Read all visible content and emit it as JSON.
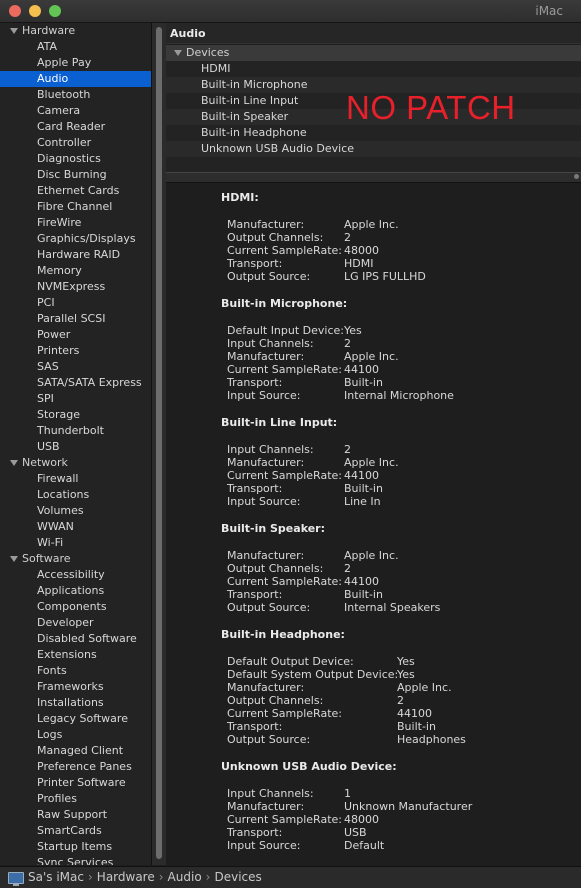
{
  "window": {
    "title": "iMac"
  },
  "sidebar": {
    "groups": [
      {
        "label": "Hardware",
        "items": [
          "ATA",
          "Apple Pay",
          "Audio",
          "Bluetooth",
          "Camera",
          "Card Reader",
          "Controller",
          "Diagnostics",
          "Disc Burning",
          "Ethernet Cards",
          "Fibre Channel",
          "FireWire",
          "Graphics/Displays",
          "Hardware RAID",
          "Memory",
          "NVMExpress",
          "PCI",
          "Parallel SCSI",
          "Power",
          "Printers",
          "SAS",
          "SATA/SATA Express",
          "SPI",
          "Storage",
          "Thunderbolt",
          "USB"
        ]
      },
      {
        "label": "Network",
        "items": [
          "Firewall",
          "Locations",
          "Volumes",
          "WWAN",
          "Wi-Fi"
        ]
      },
      {
        "label": "Software",
        "items": [
          "Accessibility",
          "Applications",
          "Components",
          "Developer",
          "Disabled Software",
          "Extensions",
          "Fonts",
          "Frameworks",
          "Installations",
          "Legacy Software",
          "Logs",
          "Managed Client",
          "Preference Panes",
          "Printer Software",
          "Profiles",
          "Raw Support",
          "SmartCards",
          "Startup Items",
          "Sync Services"
        ]
      }
    ],
    "selected": "Audio"
  },
  "main": {
    "section_title": "Audio",
    "devices_group": "Devices",
    "devices": [
      "HDMI",
      "Built-in Microphone",
      "Built-in Line Input",
      "Built-in Speaker",
      "Built-in Headphone",
      "Unknown USB Audio Device"
    ],
    "overlay_text": "NO PATCH"
  },
  "details": [
    {
      "title": "HDMI:",
      "props": [
        [
          "Manufacturer:",
          "Apple Inc."
        ],
        [
          "Output Channels:",
          "2"
        ],
        [
          "Current SampleRate:",
          "48000"
        ],
        [
          "Transport:",
          "HDMI"
        ],
        [
          "Output Source:",
          "LG IPS FULLHD"
        ]
      ]
    },
    {
      "title": "Built-in Microphone:",
      "props": [
        [
          "Default Input Device:",
          "Yes"
        ],
        [
          "Input Channels:",
          "2"
        ],
        [
          "Manufacturer:",
          "Apple Inc."
        ],
        [
          "Current SampleRate:",
          "44100"
        ],
        [
          "Transport:",
          "Built-in"
        ],
        [
          "Input Source:",
          "Internal Microphone"
        ]
      ]
    },
    {
      "title": "Built-in Line Input:",
      "props": [
        [
          "Input Channels:",
          "2"
        ],
        [
          "Manufacturer:",
          "Apple Inc."
        ],
        [
          "Current SampleRate:",
          "44100"
        ],
        [
          "Transport:",
          "Built-in"
        ],
        [
          "Input Source:",
          "Line In"
        ]
      ]
    },
    {
      "title": "Built-in Speaker:",
      "props": [
        [
          "Manufacturer:",
          "Apple Inc."
        ],
        [
          "Output Channels:",
          "2"
        ],
        [
          "Current SampleRate:",
          "44100"
        ],
        [
          "Transport:",
          "Built-in"
        ],
        [
          "Output Source:",
          "Internal Speakers"
        ]
      ]
    },
    {
      "title": "Built-in Headphone:",
      "props": [
        [
          "Default Output Device:",
          "Yes"
        ],
        [
          "Default System Output Device:",
          "Yes"
        ],
        [
          "Manufacturer:",
          "Apple Inc."
        ],
        [
          "Output Channels:",
          "2"
        ],
        [
          "Current SampleRate:",
          "44100"
        ],
        [
          "Transport:",
          "Built-in"
        ],
        [
          "Output Source:",
          "Headphones"
        ]
      ]
    },
    {
      "title": "Unknown USB Audio Device:",
      "props": [
        [
          "Input Channels:",
          "1"
        ],
        [
          "Manufacturer:",
          "Unknown Manufacturer"
        ],
        [
          "Current SampleRate:",
          "48000"
        ],
        [
          "Transport:",
          "USB"
        ],
        [
          "Input Source:",
          "Default"
        ]
      ]
    }
  ],
  "pathbar": {
    "crumbs": [
      "Sa's iMac",
      "Hardware",
      "Audio",
      "Devices"
    ],
    "separator": "›"
  },
  "colors": {
    "selection": "#0a5fd1",
    "overlay": "#e8202a",
    "background": "#1e1e1e"
  }
}
